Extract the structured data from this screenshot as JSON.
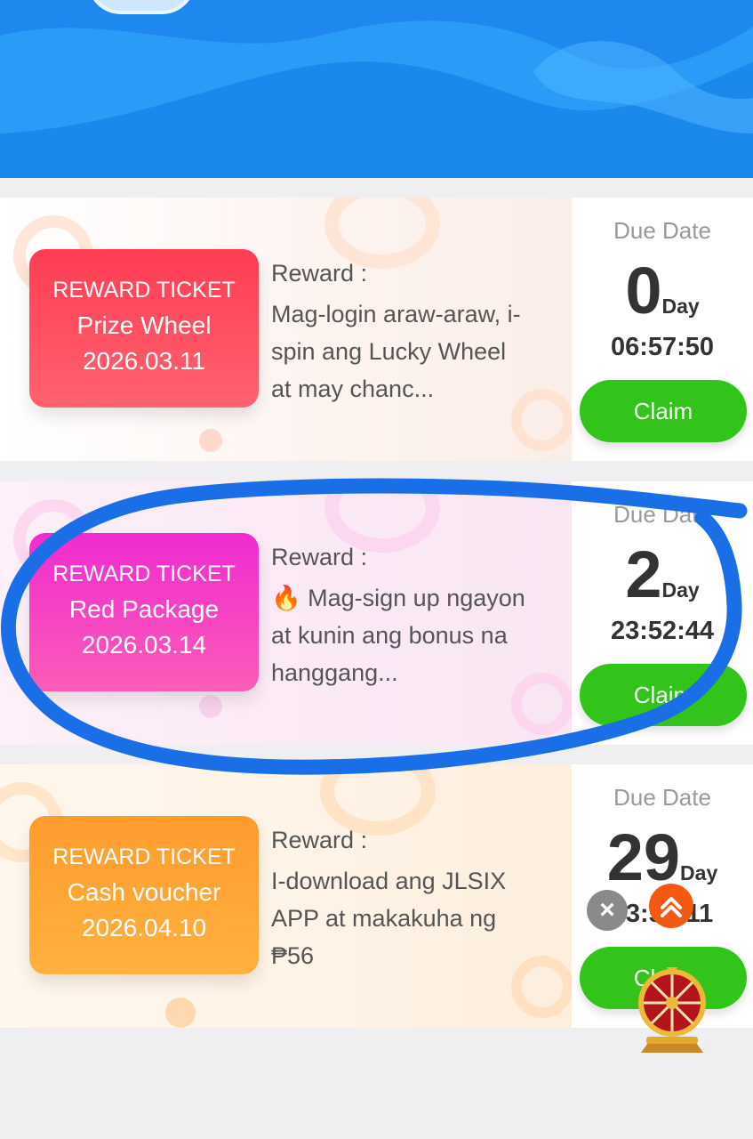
{
  "tickets": [
    {
      "ticket_label": "REWARD TICKET",
      "name": "Prize Wheel",
      "date": "2026.03.11",
      "reward_label": "Reward :",
      "description": "Mag-login araw-araw, i-spin ang Lucky Wheel at may chanc...",
      "due_label": "Due Date",
      "days": "0",
      "days_unit": "Day",
      "time": "06:57:50",
      "claim_label": "Claim",
      "ticket_color": "#ff4b5f"
    },
    {
      "ticket_label": "REWARD TICKET",
      "name": "Red Package",
      "date": "2026.03.14",
      "reward_label": "Reward :",
      "description": "🔥 Mag-sign up ngayon at kunin ang bonus na hanggang...",
      "due_label": "Due Date",
      "days": "2",
      "days_unit": "Day",
      "time": "23:52:44",
      "claim_label": "Claim",
      "ticket_color": "#f23bbf"
    },
    {
      "ticket_label": "REWARD TICKET",
      "name": "Cash voucher",
      "date": "2026.04.10",
      "reward_label": "Reward :",
      "description": "I-download ang JLSIX APP at makakuha ng ₱56",
      "due_label": "Due Date",
      "days": "29",
      "days_unit": "Day",
      "time": "23:59:11",
      "claim_label": "Claim",
      "ticket_color": "#ffa534"
    }
  ],
  "floating": {
    "close_icon": "close-icon",
    "scroll_top_icon": "double-chevron-up-icon",
    "wheel_icon": "lucky-wheel-icon"
  },
  "colors": {
    "header_blue": "#1e88ee",
    "claim_green": "#33c41c",
    "annotation_blue": "#1a6fe6"
  }
}
